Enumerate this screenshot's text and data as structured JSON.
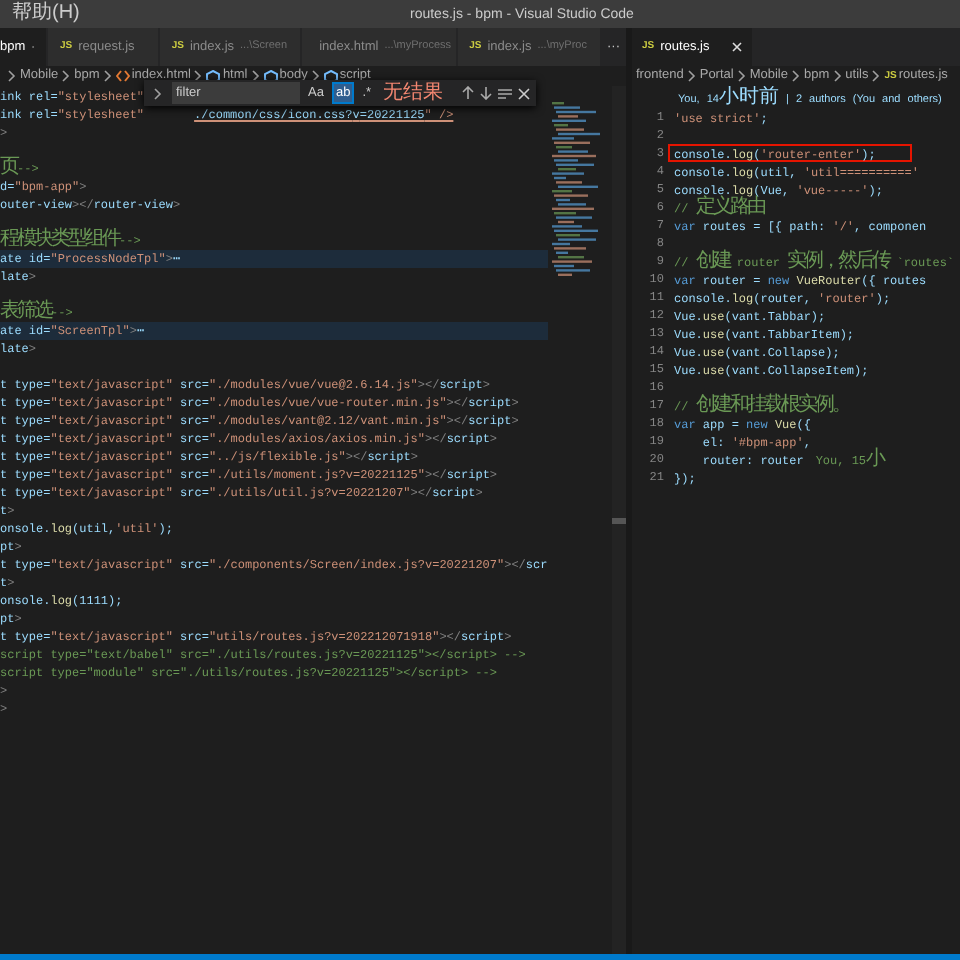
{
  "title_bar": {
    "menu": "帮助(H)",
    "title": "routes.js - bpm - Visual Studio Code"
  },
  "left_editor": {
    "tabs": [
      {
        "label": "bpm",
        "selected": true
      },
      {
        "label": "request.js",
        "icon": "JS",
        "kind": "js",
        "selected": false
      },
      {
        "label": "index.js",
        "detail": "...\\Screen",
        "icon": "JS",
        "kind": "js",
        "selected": false
      },
      {
        "label": "index.html",
        "detail": "...\\myProcess",
        "kind": "html",
        "selected": false
      },
      {
        "label": "index.js",
        "detail": "...\\myProc",
        "icon": "JS",
        "kind": "js",
        "selected": false
      }
    ],
    "more": "···",
    "breadcrumbs": [
      {
        "label": "Mobile",
        "kind": "folder"
      },
      {
        "label": "bpm",
        "kind": "folder"
      },
      {
        "label": "index.html",
        "kind": "html"
      },
      {
        "label": "html",
        "kind": "element"
      },
      {
        "label": "body",
        "kind": "element"
      },
      {
        "label": "script",
        "kind": "element"
      }
    ],
    "find": {
      "value": "filter",
      "options": [
        {
          "label": "Aa",
          "selected": false
        },
        {
          "label": "ab",
          "selected": true
        },
        {
          "label": ".*",
          "selected": false
        }
      ],
      "result": "无结果"
    },
    "lines": [
      {
        "text": "ink rel=\"stylesheet\"",
        "kind": "code",
        "highlighted": false
      },
      {
        "text": "ink rel=\"stylesheet\"",
        "tail": "./common/css/icon.css?v=20221125\" />",
        "kind": "code",
        "highlighted": false
      },
      {
        "text": ">",
        "kind": "code",
        "highlighted": false
      },
      {
        "highlighted": false
      },
      {
        "text": "页-->",
        "kind": "comment",
        "highlighted": false
      },
      {
        "text": "d=\"bpm-app\">",
        "kind": "code",
        "highlighted": false
      },
      {
        "text": "outer-view></router-view>",
        "kind": "code",
        "highlighted": false
      },
      {
        "highlighted": false
      },
      {
        "text": "程模块类型组件-->",
        "kind": "comment",
        "highlighted": false
      },
      {
        "text": "ate id=\"ProcessNodeTpl\">⋯",
        "kind": "code",
        "highlighted": true
      },
      {
        "text": "late>",
        "kind": "code",
        "highlighted": false
      },
      {
        "highlighted": false
      },
      {
        "text": "表筛选-->",
        "kind": "comment",
        "highlighted": false
      },
      {
        "text": "ate id=\"ScreenTpl\">⋯",
        "kind": "code",
        "highlighted": true
      },
      {
        "text": "late>",
        "kind": "code",
        "highlighted": false
      },
      {
        "highlighted": false
      },
      {
        "text": "t type=\"text/javascript\" src=\"./modules/vue/vue@2.6.14.js\"></script>",
        "kind": "code",
        "highlighted": false
      },
      {
        "text": "t type=\"text/javascript\" src=\"./modules/vue/vue-router.min.js\"></script>",
        "kind": "code",
        "highlighted": false
      },
      {
        "text": "t type=\"text/javascript\" src=\"./modules/vant@2.12/vant.min.js\"></script>",
        "kind": "code",
        "highlighted": false
      },
      {
        "text": "t type=\"text/javascript\" src=\"./modules/axios/axios.min.js\"></script>",
        "kind": "code",
        "highlighted": false
      },
      {
        "text": "t type=\"text/javascript\" src=\"../js/flexible.js\"></script>",
        "kind": "code",
        "highlighted": false
      },
      {
        "text": "t type=\"text/javascript\" src=\"./utils/moment.js?v=20221125\"></script>",
        "kind": "code",
        "highlighted": false
      },
      {
        "text": "t type=\"text/javascript\" src=\"./utils/util.js?v=20221207\"></script>",
        "kind": "code",
        "highlighted": false
      },
      {
        "text": "t>",
        "kind": "code",
        "highlighted": false
      },
      {
        "text": "onsole.log(util,'util');",
        "kind": "code",
        "highlighted": false
      },
      {
        "text": "pt>",
        "kind": "code",
        "highlighted": false
      },
      {
        "text": "t type=\"text/javascript\" src=\"./components/Screen/index.js?v=20221207\"></scr",
        "kind": "code",
        "highlighted": false
      },
      {
        "text": "t>",
        "kind": "code",
        "highlighted": false
      },
      {
        "text": "onsole.log(1111);",
        "kind": "code",
        "highlighted": false
      },
      {
        "text": "pt>",
        "kind": "code",
        "highlighted": false
      },
      {
        "text": "t type=\"text/javascript\" src=\"utils/routes.js?v=202212071918\"></script>",
        "kind": "code",
        "highlighted": false
      },
      {
        "text": "script type=\"text/babel\" src=\"./utils/routes.js?v=20221125\"></script> -->",
        "kind": "comment",
        "highlighted": false
      },
      {
        "text": "script type=\"module\" src=\"./utils/routes.js?v=20221125\"></script> -->",
        "kind": "comment",
        "highlighted": false
      },
      {
        "text": ">",
        "kind": "code",
        "highlighted": false
      },
      {
        "text": ">",
        "kind": "code",
        "highlighted": false
      }
    ]
  },
  "right_editor": {
    "tab": {
      "label": "routes.js",
      "icon": "JS",
      "kind": "js",
      "selected": true
    },
    "breadcrumbs": [
      {
        "label": "frontend",
        "kind": "folder"
      },
      {
        "label": "Portal",
        "kind": "folder"
      },
      {
        "label": "Mobile",
        "kind": "folder"
      },
      {
        "label": "bpm",
        "kind": "folder"
      },
      {
        "label": "utils",
        "kind": "folder"
      },
      {
        "label": "routes.js",
        "icon": "JS",
        "kind": "js"
      }
    ],
    "codelens": "You, 14小时前 | 2 authors (You and others)",
    "lines": [
      {
        "number": "1",
        "text": "'use strict';",
        "kind": "code",
        "boxed": false
      },
      {
        "number": "2",
        "boxed": false
      },
      {
        "number": "3",
        "text": "console.log('router-enter');",
        "kind": "code",
        "boxed": true
      },
      {
        "number": "4",
        "text": "console.log(util, 'util=========='",
        "kind": "code",
        "boxed": false
      },
      {
        "number": "5",
        "text": "console.log(Vue, 'vue-----');",
        "kind": "code",
        "boxed": false
      },
      {
        "number": "6",
        "text": "// 定义路由",
        "kind": "comment",
        "boxed": false
      },
      {
        "number": "7",
        "text": "var routes = [{ path: '/', componen",
        "kind": "code",
        "boxed": false
      },
      {
        "number": "8",
        "boxed": false
      },
      {
        "number": "9",
        "text": "// 创建 router 实例，然后传 `routes`",
        "kind": "comment",
        "boxed": false
      },
      {
        "number": "10",
        "text": "var router = new VueRouter({ routes",
        "kind": "code",
        "boxed": false
      },
      {
        "number": "11",
        "text": "console.log(router, 'router');",
        "kind": "code",
        "boxed": false
      },
      {
        "number": "12",
        "text": "Vue.use(vant.Tabbar);",
        "kind": "code",
        "boxed": false
      },
      {
        "number": "13",
        "text": "Vue.use(vant.TabbarItem);",
        "kind": "code",
        "boxed": false
      },
      {
        "number": "14",
        "text": "Vue.use(vant.Collapse);",
        "kind": "code",
        "boxed": false
      },
      {
        "number": "15",
        "text": "Vue.use(vant.CollapseItem);",
        "kind": "code",
        "boxed": false
      },
      {
        "number": "16",
        "boxed": false
      },
      {
        "number": "17",
        "text": "// 创建和挂载根实例。",
        "kind": "comment",
        "boxed": false
      },
      {
        "number": "18",
        "text": "var app = new Vue({",
        "kind": "code",
        "boxed": false
      },
      {
        "number": "19",
        "text": "    el: '#bpm-app',",
        "kind": "code",
        "boxed": false
      },
      {
        "number": "20",
        "text": "    router: router",
        "blame": "You, 15小",
        "kind": "code",
        "boxed": false
      },
      {
        "number": "21",
        "text": "});",
        "kind": "code",
        "boxed": false
      }
    ]
  }
}
